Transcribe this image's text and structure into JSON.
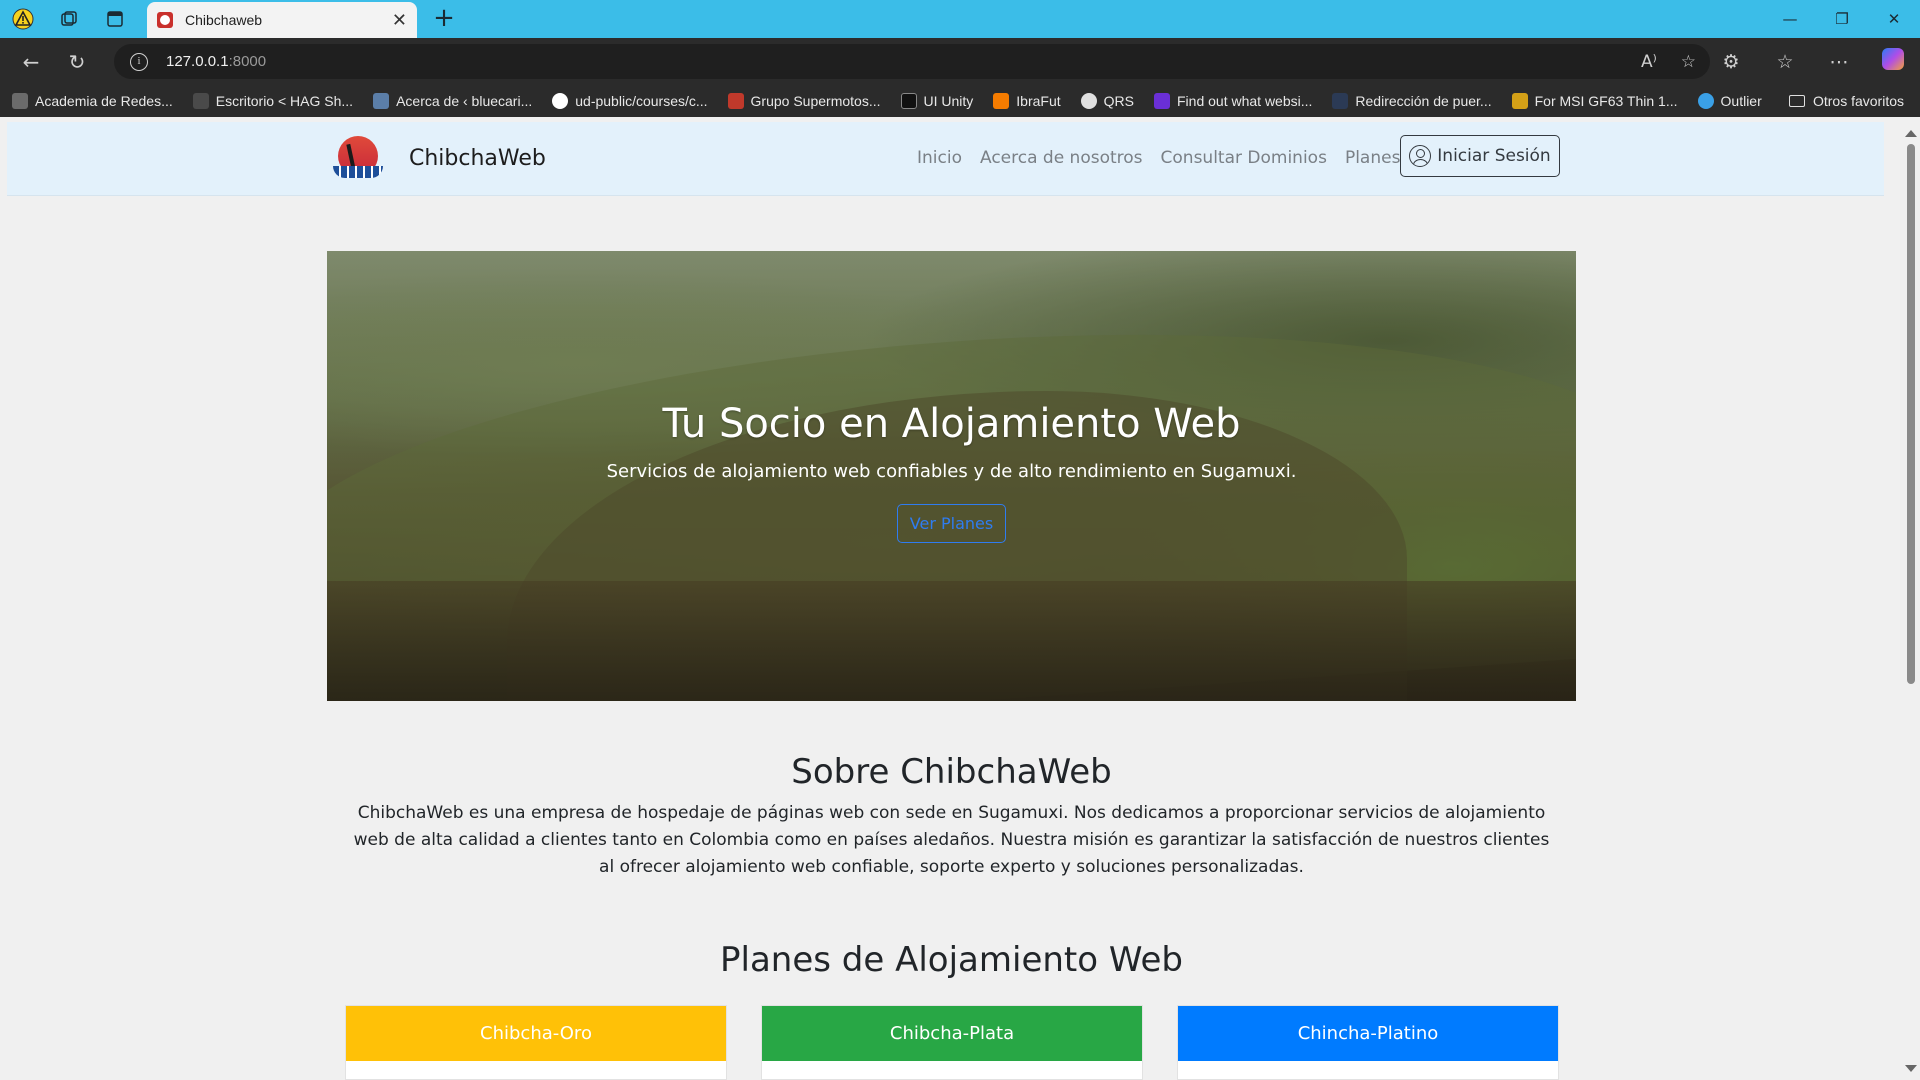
{
  "browser": {
    "tab_title": "Chibchaweb",
    "url_host": "127.0.0.1",
    "url_port": ":8000",
    "bookmarks": [
      {
        "label": "Academia de Redes...",
        "color": "#6b6b6b"
      },
      {
        "label": "Escritorio < HAG Sh...",
        "color": "#4a4a4a"
      },
      {
        "label": "Acerca de ‹ bluecari...",
        "color": "#5b7ea8"
      },
      {
        "label": "ud-public/courses/c...",
        "color": "#ffffff"
      },
      {
        "label": "Grupo Supermotos...",
        "color": "#c0392b"
      },
      {
        "label": "UI Unity",
        "color": "#111111"
      },
      {
        "label": "IbraFut",
        "color": "#f57c00"
      },
      {
        "label": "QRS",
        "color": "#e0e0e0"
      },
      {
        "label": "Find out what websi...",
        "color": "#6a2fd6"
      },
      {
        "label": "Redirección de puer...",
        "color": "#2b3a55"
      },
      {
        "label": "For MSI GF63 Thin 1...",
        "color": "#d4a017"
      },
      {
        "label": "Outlier",
        "color": "#3aa0e6"
      }
    ],
    "other_favorites": "Otros favoritos"
  },
  "site": {
    "brand": "ChibchaWeb",
    "nav": {
      "inicio": "Inicio",
      "acerca": "Acerca de nosotros",
      "dominios": "Consultar Dominios",
      "planes": "Planes"
    },
    "login": "Iniciar Sesión",
    "hero": {
      "title": "Tu Socio en Alojamiento Web",
      "subtitle": "Servicios de alojamiento web confiables y de alto rendimiento en Sugamuxi.",
      "button": "Ver Planes"
    },
    "about": {
      "title": "Sobre ChibchaWeb",
      "text": "ChibchaWeb es una empresa de hospedaje de páginas web con sede en Sugamuxi. Nos dedicamos a proporcionar servicios de alojamiento web de alta calidad a clientes tanto en Colombia como en países aledaños. Nuestra misión es garantizar la satisfacción de nuestros clientes al ofrecer alojamiento web confiable, soporte experto y soluciones personalizadas."
    },
    "plans_title": "Planes de Alojamiento Web",
    "plans": [
      {
        "name": "Chibcha-Oro",
        "color": "#ffc107"
      },
      {
        "name": "Chibcha-Plata",
        "color": "#28a745"
      },
      {
        "name": "Chincha-Platino",
        "color": "#007bff"
      }
    ]
  }
}
